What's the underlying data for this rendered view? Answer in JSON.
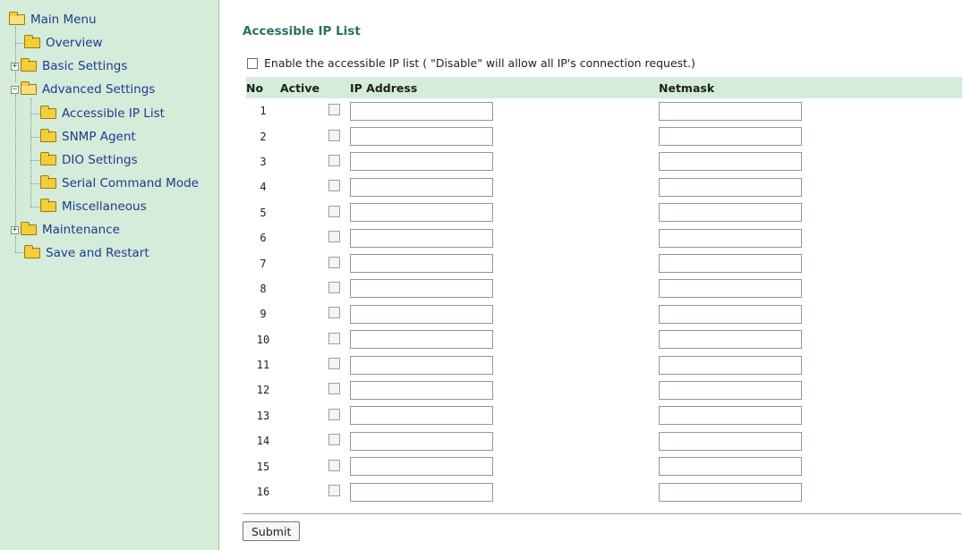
{
  "sidebar": {
    "items": [
      {
        "label": "Main Menu"
      },
      {
        "label": "Overview"
      },
      {
        "label": "Basic Settings"
      },
      {
        "label": "Advanced Settings"
      },
      {
        "label": "Accessible IP List"
      },
      {
        "label": "SNMP Agent"
      },
      {
        "label": "DIO Settings"
      },
      {
        "label": "Serial Command Mode"
      },
      {
        "label": "Miscellaneous"
      },
      {
        "label": "Maintenance"
      },
      {
        "label": "Save and Restart"
      }
    ]
  },
  "main": {
    "title": "Accessible IP List",
    "enable_label": "Enable the accessible IP list ( \"Disable\" will allow all IP's connection request.)",
    "columns": [
      "No",
      "Active",
      "IP Address",
      "Netmask"
    ],
    "rows": [
      {
        "no": "1",
        "ip": "",
        "netmask": ""
      },
      {
        "no": "2",
        "ip": "",
        "netmask": ""
      },
      {
        "no": "3",
        "ip": "",
        "netmask": ""
      },
      {
        "no": "4",
        "ip": "",
        "netmask": ""
      },
      {
        "no": "5",
        "ip": "",
        "netmask": ""
      },
      {
        "no": "6",
        "ip": "",
        "netmask": ""
      },
      {
        "no": "7",
        "ip": "",
        "netmask": ""
      },
      {
        "no": "8",
        "ip": "",
        "netmask": ""
      },
      {
        "no": "9",
        "ip": "",
        "netmask": ""
      },
      {
        "no": "10",
        "ip": "",
        "netmask": ""
      },
      {
        "no": "11",
        "ip": "",
        "netmask": ""
      },
      {
        "no": "12",
        "ip": "",
        "netmask": ""
      },
      {
        "no": "13",
        "ip": "",
        "netmask": ""
      },
      {
        "no": "14",
        "ip": "",
        "netmask": ""
      },
      {
        "no": "15",
        "ip": "",
        "netmask": ""
      },
      {
        "no": "16",
        "ip": "",
        "netmask": ""
      }
    ],
    "submit_label": "Submit"
  },
  "colors": {
    "sidebar_bg": "#d4ecd9",
    "header_bg": "#d4ecd9",
    "title": "#2b6f64",
    "link": "#1f3a8f",
    "folder": "#f4cd3a"
  }
}
